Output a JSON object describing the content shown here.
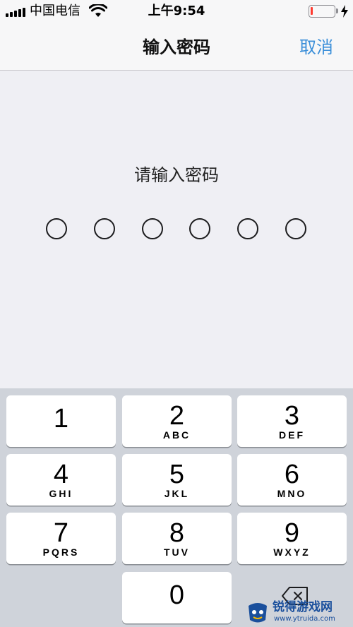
{
  "status_bar": {
    "carrier": "中国电信",
    "time": "上午9:54",
    "battery_level": 0.1,
    "battery_color": "#ff3b30",
    "icons": [
      "signal-icon",
      "wifi-icon",
      "battery-icon",
      "charging-bolt-icon"
    ]
  },
  "nav": {
    "title": "输入密码",
    "cancel_label": "取消",
    "accent_color": "#3b8fd9"
  },
  "passcode": {
    "prompt": "请输入密码",
    "length": 6,
    "entered": 0
  },
  "keypad": {
    "keys": [
      {
        "digit": "1",
        "letters": ""
      },
      {
        "digit": "2",
        "letters": "ABC"
      },
      {
        "digit": "3",
        "letters": "DEF"
      },
      {
        "digit": "4",
        "letters": "GHI"
      },
      {
        "digit": "5",
        "letters": "JKL"
      },
      {
        "digit": "6",
        "letters": "MNO"
      },
      {
        "digit": "7",
        "letters": "PQRS"
      },
      {
        "digit": "8",
        "letters": "TUV"
      },
      {
        "digit": "9",
        "letters": "WXYZ"
      },
      {
        "digit": "0",
        "letters": ""
      }
    ],
    "delete_icon": "backspace-icon"
  },
  "watermark": {
    "title": "锐得游戏网",
    "url": "www.ytruida.com"
  }
}
